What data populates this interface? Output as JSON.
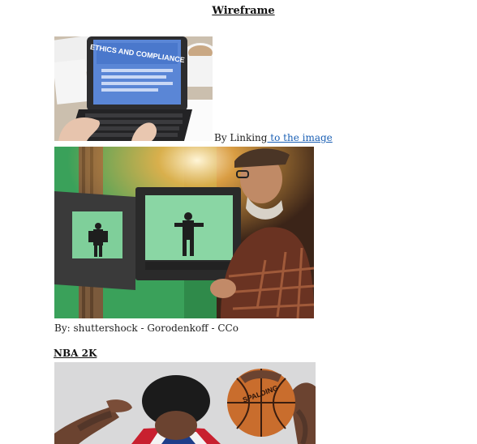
{
  "page": {
    "title": "Wireframe"
  },
  "figure1": {
    "screen_text": "ETHICS AND COMPLIANCE",
    "caption_prefix": "By Linking",
    "caption_link": " to the image"
  },
  "figure2": {
    "caption": "By: shuttershock - Gorodenkoff - CCo"
  },
  "section": {
    "title": "NBA 2K"
  },
  "figure3": {
    "ball_text": "SPALDING"
  },
  "colors": {
    "link": "#1a5fb4",
    "text": "#222222",
    "greenscreen": "#3aa15a",
    "jersey_red": "#c8202f"
  }
}
